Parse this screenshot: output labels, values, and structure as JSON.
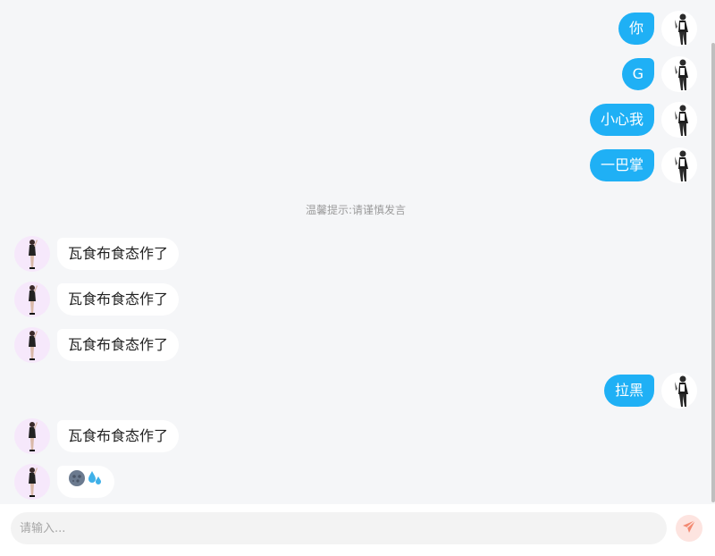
{
  "notice": "温馨提示:请谨慎发言",
  "messages": [
    {
      "from": "me",
      "text": "你"
    },
    {
      "from": "me",
      "text": "G"
    },
    {
      "from": "me",
      "text": "小心我"
    },
    {
      "from": "me",
      "text": "一巴掌"
    },
    {
      "from": "other",
      "text": "瓦食布食态作了"
    },
    {
      "from": "other",
      "text": "瓦食布食态作了"
    },
    {
      "from": "other",
      "text": "瓦食布食态作了"
    },
    {
      "from": "me",
      "text": "拉黑"
    },
    {
      "from": "other",
      "text": "瓦食布食态作了"
    },
    {
      "from": "other",
      "text": "",
      "icons": [
        "new-moon-face-icon",
        "sweat-droplets-icon"
      ]
    }
  ],
  "input": {
    "placeholder": "请输入...",
    "value": ""
  },
  "colors": {
    "my_bubble": "#1fb0f5",
    "other_bubble": "#ffffff",
    "send_button": "#fde4e0",
    "send_icon": "#f38a73"
  }
}
